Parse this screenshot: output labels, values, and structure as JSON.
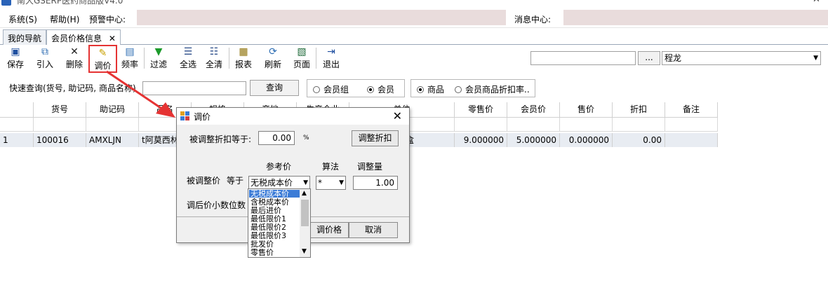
{
  "window": {
    "title": "南大GSERP医药商品版V4.0"
  },
  "menu": {
    "system": "系统(S)",
    "help": "帮助(H)",
    "alert_center": "预警中心:",
    "message_center": "消息中心:"
  },
  "tabs": [
    {
      "label": "我的导航"
    },
    {
      "label": "会员价格信息",
      "close": "✕"
    }
  ],
  "toolbar": {
    "buttons": [
      {
        "label": "保存",
        "icon": "save-icon"
      },
      {
        "label": "引入",
        "icon": "import-icon"
      },
      {
        "label": "删除",
        "icon": "delete-icon"
      },
      {
        "label": "调价",
        "icon": "price-adjust-icon"
      },
      {
        "label": "频率",
        "icon": "frequency-icon"
      },
      {
        "label": "过滤",
        "icon": "filter-icon"
      },
      {
        "label": "全选",
        "icon": "select-all-icon"
      },
      {
        "label": "全清",
        "icon": "clear-all-icon"
      },
      {
        "label": "报表",
        "icon": "report-icon"
      },
      {
        "label": "刷新",
        "icon": "refresh-icon"
      },
      {
        "label": "页面",
        "icon": "page-icon"
      },
      {
        "label": "退出",
        "icon": "exit-icon"
      }
    ],
    "browse_label": "...",
    "user_select": "程龙"
  },
  "quick_query": {
    "label": "快速查询(货号, 助记码, 商品名称)",
    "button": "查询",
    "radio_group1": [
      {
        "label": "会员组",
        "checked": false
      },
      {
        "label": "会员",
        "checked": true
      }
    ],
    "radio_group2": [
      {
        "label": "商品",
        "checked": true
      },
      {
        "label": "会员商品折扣率..",
        "checked": false
      }
    ]
  },
  "grid": {
    "columns": [
      "货号",
      "助记码",
      "品名",
      "规格",
      "产地",
      "生产企业",
      "单位",
      "零售价",
      "会员价",
      "售价",
      "折扣",
      "备注"
    ],
    "rows": [
      {
        "index": "1",
        "code": "100016",
        "mnemonic": "AMXLJN",
        "name": "t阿莫西林",
        "unit": "盒",
        "retail_price": "9.000000",
        "member_price": "5.000000",
        "sale_price": "0.000000",
        "discount": "0.00"
      }
    ]
  },
  "dialog": {
    "title": "调价",
    "discount_label": "被调整折扣等于:",
    "discount_value": "0.00",
    "percent": "%",
    "adjust_discount_btn": "调整折扣",
    "ref_price_header": "参考价",
    "method_header": "算法",
    "amount_header": "调整量",
    "adjusted_label": "被调整价",
    "equals_label": "等于",
    "ref_price_selected": "无税成本价",
    "method_selected": "*",
    "amount_value": "1.00",
    "decimals_label": "调后价小数位数",
    "adjust_price_btn": "调价格",
    "cancel_btn": "取消"
  },
  "dropdown": {
    "options": [
      "无税成本价",
      "含税成本价",
      "最后进价",
      "最低限价1",
      "最低限价2",
      "最低限价3",
      "批发价",
      "零售价"
    ]
  },
  "colors": {
    "highlight": "#e53333",
    "selected_option": "#3b7bd6"
  }
}
